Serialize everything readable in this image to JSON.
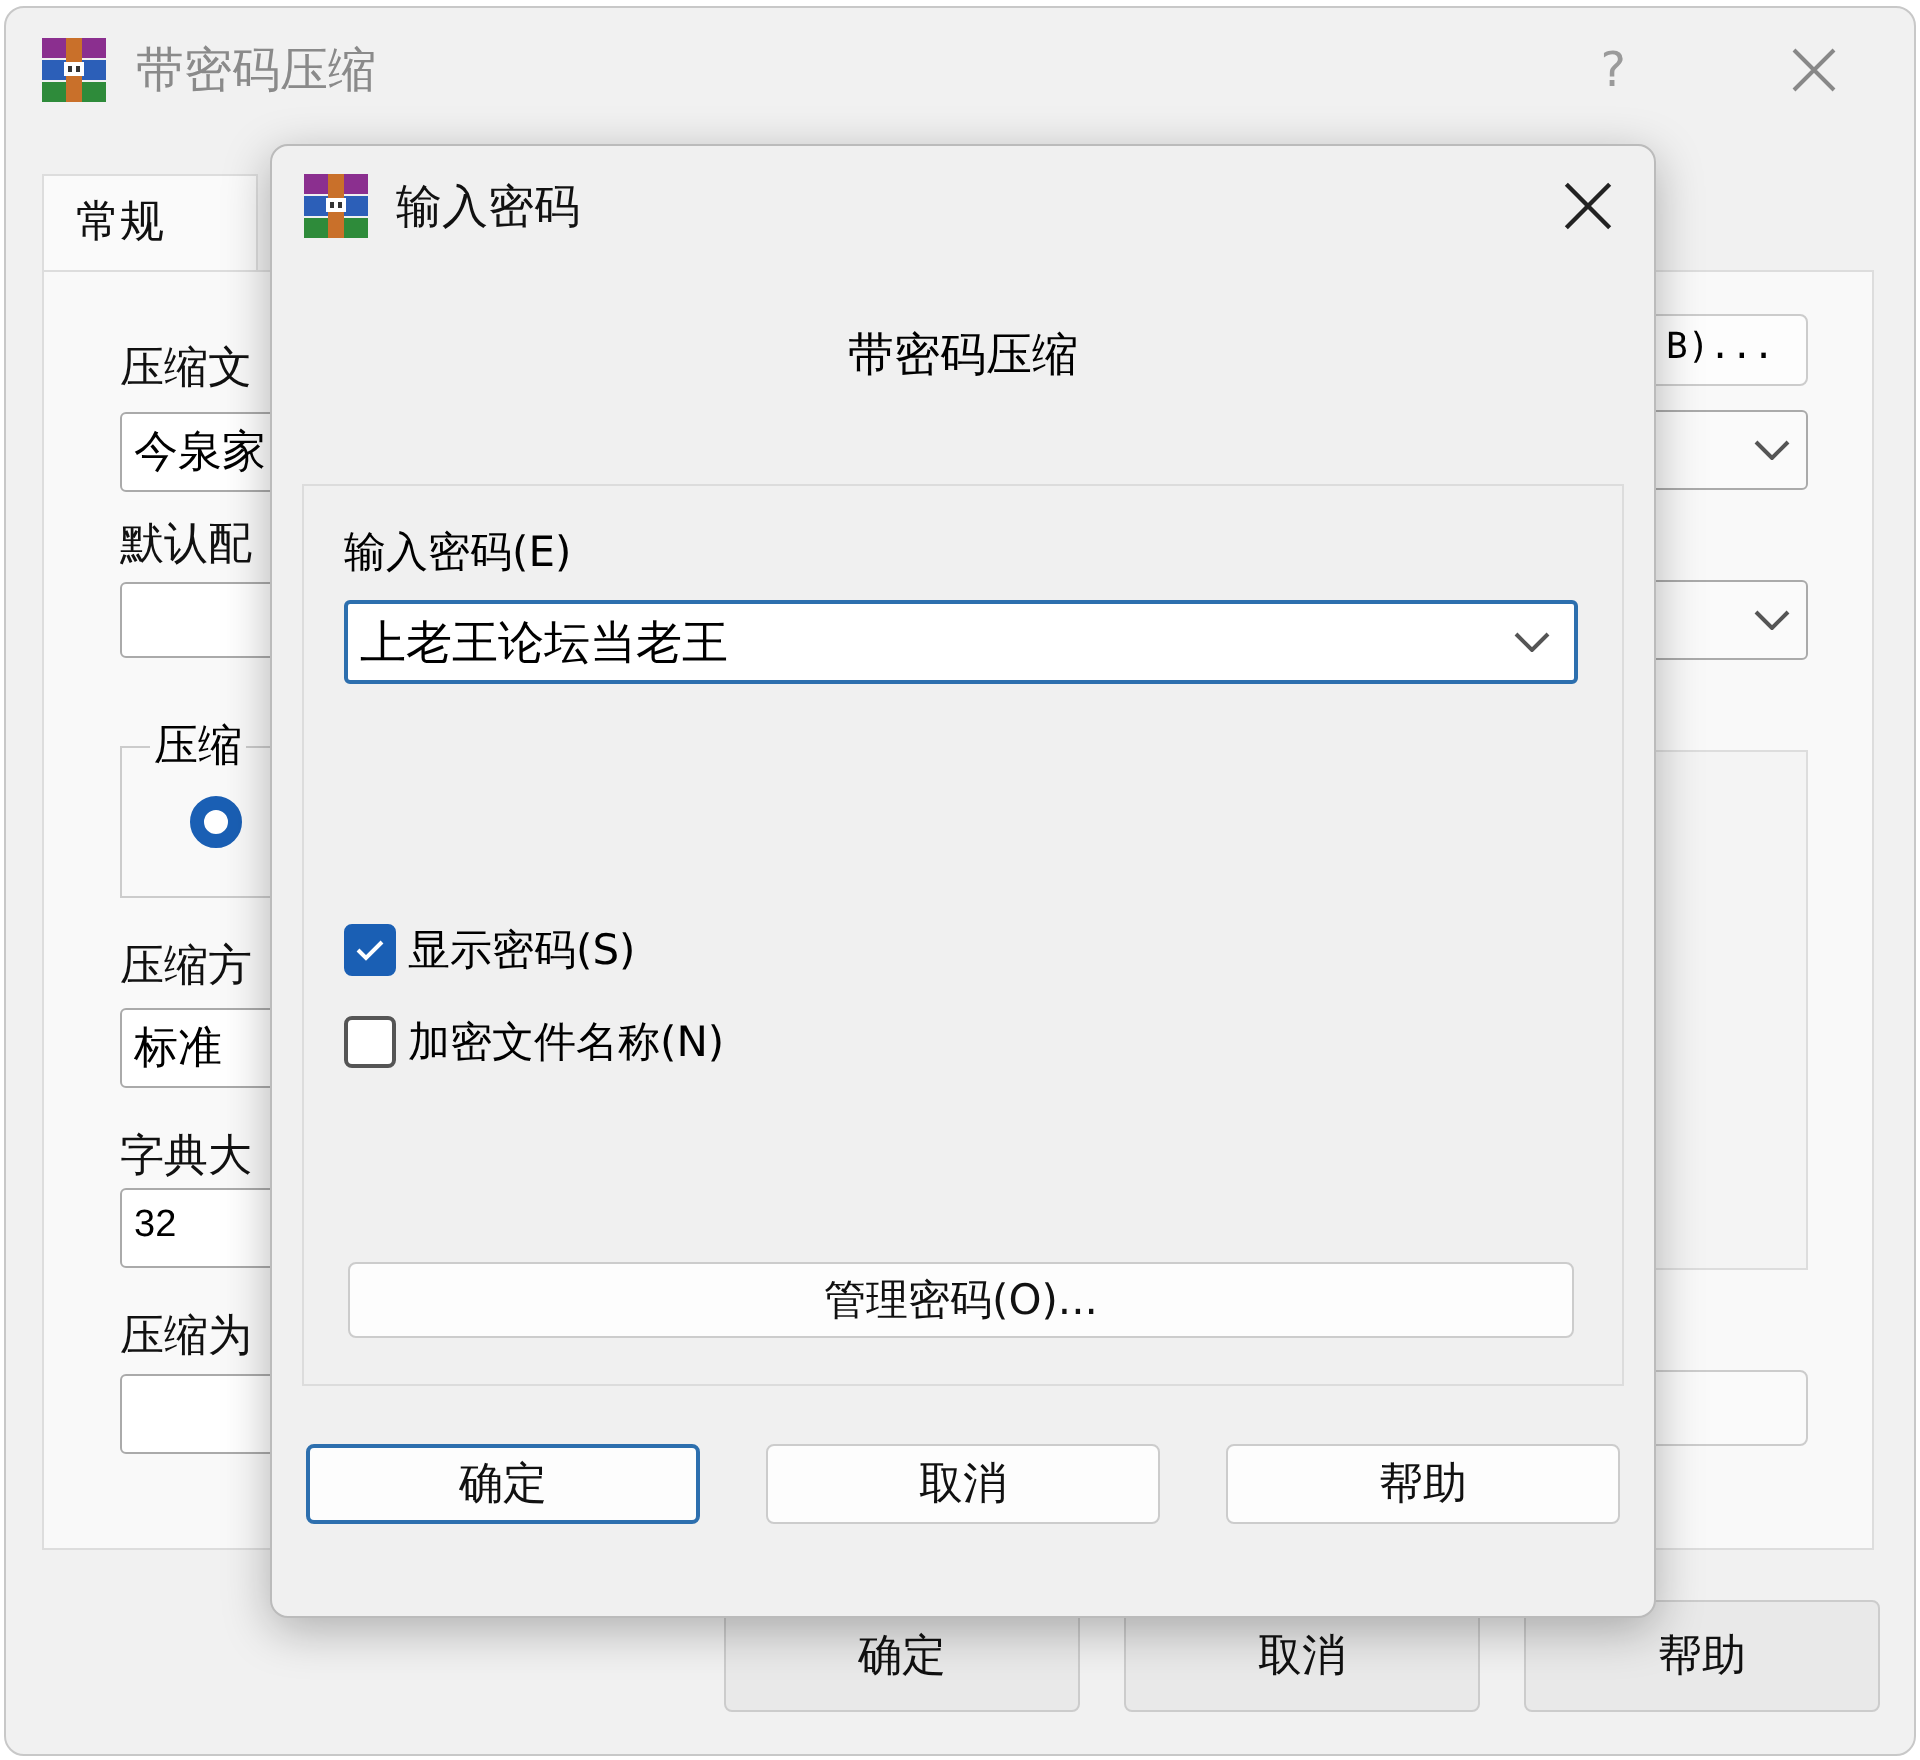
{
  "main_window": {
    "title": "带密码压缩",
    "help": "?",
    "tabs": [
      {
        "label": "常规",
        "selected": true
      }
    ],
    "left": {
      "archive_label": "压缩文",
      "archive_value": "今泉家",
      "profile_label": "默认配",
      "format_group": "压缩",
      "format_radio_selected": true,
      "method_label": "压缩方",
      "method_value": "标准",
      "dict_label": "字典大",
      "dict_value": "32",
      "split_label": "压缩为"
    },
    "browse_button": "B)...",
    "buttons": [
      {
        "label": "确定"
      },
      {
        "label": "取消"
      },
      {
        "label": "帮助"
      }
    ]
  },
  "dialog": {
    "title": "输入密码",
    "heading": "带密码压缩",
    "password": {
      "label": "输入密码(E)",
      "value": "上老王论坛当老王"
    },
    "options": [
      {
        "label": "显示密码(S)",
        "checked": true
      },
      {
        "label": "加密文件名称(N)",
        "checked": false
      }
    ],
    "manage_button": "管理密码(O)...",
    "buttons": [
      {
        "label": "确定",
        "default": true
      },
      {
        "label": "取消",
        "default": false
      },
      {
        "label": "帮助",
        "default": false
      }
    ]
  }
}
